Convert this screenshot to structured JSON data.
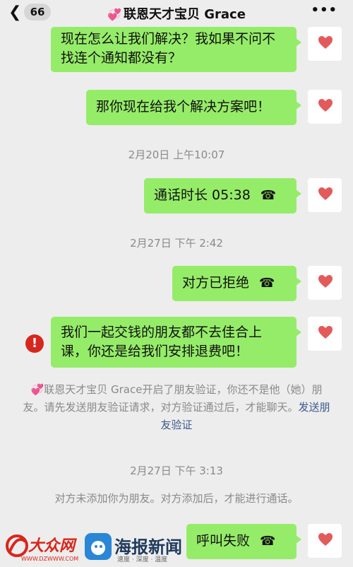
{
  "header": {
    "back_count": "66",
    "title": "联恩天才宝贝 Grace"
  },
  "messages": [
    {
      "text": "现在怎么让我们解决？我如果不问不找连个通知都没有？"
    },
    {
      "text": "那你现在给我个解决方案吧！"
    },
    {
      "text": "通话时长 05:38"
    },
    {
      "text": "对方已拒绝"
    },
    {
      "text": "我们一起交钱的朋友都不去佳合上课，你还是给我们安排退费吧！"
    },
    {
      "text": "呼叫失败"
    }
  ],
  "timestamps": [
    "2月20日 上午10:07",
    "2月27日 下午 2:42",
    "2月27日 下午 3:13"
  ],
  "system": {
    "friend_verify_text": "联恩天才宝贝 Grace开启了朋友验证，你还不是他（她）朋友。请先发送朋友验证请求，对方验证通过后，才能聊天。",
    "send_verify_link": "发送朋友验证",
    "not_added_text": "对方未添加你为朋友。对方添加后，才能进行通话。"
  },
  "error_badge": "!",
  "watermark": {
    "left_logo": "大众网",
    "left_url": "WWW.DZWWW.COM",
    "right_logo": "海报新闻",
    "right_sub": "速度 · 深度 · 温度"
  },
  "colors": {
    "bubble": "#95ec69",
    "background": "#ededed",
    "error": "#d6271f",
    "link": "#3c5a8c"
  }
}
